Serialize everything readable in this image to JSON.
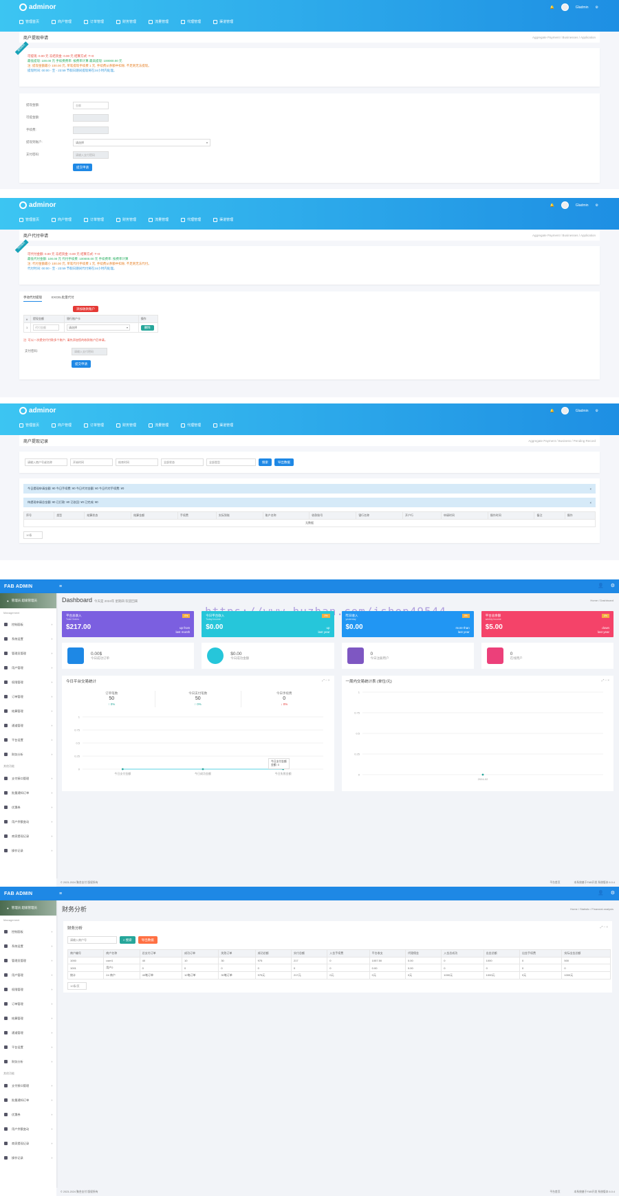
{
  "adminor": {
    "logo": "adminor",
    "user": "Gladmin",
    "menu": [
      "管理首页",
      "商户管理",
      "订单管理",
      "财务管理",
      "流量管理",
      "代理管理",
      "渠道管理"
    ]
  },
  "s1": {
    "title": "商户提现申请",
    "crumb": "Aggregate Payment / Businesses / Application",
    "ribbon": "提现规则",
    "notice": [
      "可提现: 0.00 元   冻结资金: 0.00 元   结算方式: T+0",
      "最低提现: 100.00 元   手续费费率: 按费率计算   最高提现: 100000.00 元",
      "注: 提现金额最小 100.00 元, 单笔提现手续费 1 元, 手续费从余额中扣除, 不足则无法提现。",
      "提现时间: 00:00 - 至 - 23:59 节假日期间提现将在24小时内处理。"
    ],
    "fields": [
      {
        "label": "提现金额:",
        "value": "金额"
      },
      {
        "label": "可提金额:",
        "value": ""
      },
      {
        "label": "手续费:",
        "value": ""
      },
      {
        "label": "提现到账户:",
        "value": "请选择"
      },
      {
        "label": "支付密码:",
        "value": "请输入支付密码"
      }
    ],
    "submit": "提交申请"
  },
  "s2": {
    "title": "商户代付申请",
    "crumb": "Aggregate Payment / Businesses / Application",
    "ribbon": "代付规则",
    "notice": [
      "可代付金额: 0.00 元   冻结资金: 0.00 元   结算方式: T+0",
      "最低代付金额: 100.00 元   代付手续费: 100000.00 元   手续费率: 按费率计算",
      "注: 代付金额最小 100.00 元, 单笔代付手续费 1 元, 手续费从余额中扣除, 不足则无法代付。",
      "代付时间: 00:00 - 至 - 23:59 节假日期间代付将在24小时内处理。"
    ],
    "tabs": [
      "手动代付提现",
      "EXCEL批量代付"
    ],
    "add_button": "添加收款账户",
    "headers": [
      "#",
      "提现金额",
      "银行账户卡",
      "操作"
    ],
    "row": {
      "no": "1",
      "amount": "代付金额",
      "bank": "请选择",
      "action": "删除"
    },
    "tip": "注: 可以一次提交代付款多个账户, 请先添加您的收款账户后申请。",
    "pwd_label": "支付密码:",
    "pwd_placeholder": "请输入支付密码",
    "submit": "提交申请"
  },
  "s3": {
    "title": "商户提现记录",
    "crumb": "Aggregate Payment / Business / Pending Record",
    "filters": [
      "请输入商户号或名称",
      "开始时间",
      "结束时间",
      "全部状态",
      "全部类型"
    ],
    "search": "搜索",
    "export": "导出数据",
    "alert1": "今日提现申请金额: ¥0  今日手续费: ¥0  今日代付金额: ¥0  今日代付手续费: ¥0",
    "alert2": "待提现申请总金额: ¥0  已打款: ¥0  已驳回: ¥0  已完成: ¥0",
    "headers": [
      "序号",
      "类型",
      "结算状态",
      "结算金额",
      "手续费",
      "实际到账",
      "账户名称",
      "收款账号",
      "银行名称",
      "开户行",
      "申请时间",
      "操作时间",
      "备注",
      "操作"
    ],
    "empty": "无数据",
    "pagesize": "10条"
  },
  "fab": {
    "logo": "FAB ADMIN",
    "profile": "管理员 超级管理员",
    "section1": "Management",
    "section2": "其他功能",
    "items1": [
      "控制面板",
      "系统设置",
      "管理员管理",
      "用户管理",
      "权限管理",
      "订单管理",
      "结算管理",
      "通道管理",
      "平台设置",
      "财务分析"
    ],
    "items2": [
      "支付接口管理",
      "批量通知订单",
      "优惠券",
      "用户余额变动",
      "商家提现记录",
      "操作记录"
    ],
    "footer_left": "© 2023-2024 聚合支付 版权所有",
    "footer_mid": "平台首页",
    "footer_right": "本系统基于FAB开发 系统版本 6.0.4"
  },
  "dash": {
    "title": "Dashboard",
    "subtitle": "今天是 2024年 星期四 欢迎回来",
    "crumb": "Home / Dashboard",
    "watermark": "https://www.huzhan.com/ishop49544",
    "stats": [
      {
        "label": "平台总收入",
        "sub": "Total Orders",
        "value": "$217.00",
        "badge": "0%",
        "trend": "up from",
        "trend2": "last month",
        "color": "#7b5fe0"
      },
      {
        "label": "今日平台收入",
        "sub": "Today income",
        "value": "$0.00",
        "badge": "0%",
        "trend": "up",
        "trend2": "last year",
        "color": "#26c6da"
      },
      {
        "label": "昨日收入",
        "sub": "yesterday",
        "value": "$0.00",
        "badge": "0%",
        "trend": "more than",
        "trend2": "last year",
        "color": "#2196f3"
      },
      {
        "label": "平台总余额",
        "sub": "weekly income",
        "value": "$5.00",
        "badge": "0%",
        "trend": "down",
        "trend2": "last year",
        "color": "#f44369"
      }
    ],
    "mini": [
      {
        "value": "0.00$",
        "label": "今日成功订单",
        "color": "#1e88e5",
        "round": false
      },
      {
        "value": "$0.00",
        "label": "今日成功金额",
        "color": "#26c6da",
        "round": true
      },
      {
        "value": "0",
        "label": "今日注册用户",
        "color": "#7e57c2",
        "round": false
      },
      {
        "value": "0",
        "label": "在线用户",
        "color": "#ec407a",
        "round": false
      }
    ],
    "panel1": {
      "title": "今日平台交易统计",
      "stats": [
        {
          "label": "订单笔数",
          "value": "50",
          "delta": "↑ 0%"
        },
        {
          "label": "今日支付笔数",
          "value": "50",
          "delta": "↑ 0%"
        },
        {
          "label": "今日手续费",
          "value": "0",
          "delta": "↓ 0%"
        }
      ],
      "tooltip": "今日支付金额",
      "tooltip2": "金额: 0"
    },
    "panel2": {
      "title": "一周内交易统计表 (单位/元)"
    },
    "chart_data": [
      {
        "type": "line",
        "categories": [
          "今日支付金额",
          "今日成功金额",
          "今日失败金额"
        ],
        "series": [
          {
            "name": "今日支付金额",
            "values": [
              0,
              0,
              0
            ]
          }
        ],
        "ylim": [
          0,
          1
        ],
        "ytick_labels": [
          "1",
          "0.75",
          "0.5",
          "0.25",
          "0"
        ]
      },
      {
        "type": "scatter",
        "categories": [
          "2024-02"
        ],
        "series": [
          {
            "values": [
              0
            ]
          }
        ],
        "ylim": [
          0,
          1
        ],
        "ytick_labels": [
          "1",
          "0.75",
          "0.5",
          "0.25",
          "0"
        ]
      }
    ]
  },
  "fin": {
    "title": "财务分析",
    "crumb": "Home / Statistic / Financial analysis",
    "panel_title": "财务分析",
    "input_placeholder": "请输入商户号",
    "search": "搜索",
    "export": "导出数据",
    "headers": [
      "商户编号",
      "商户名称",
      "总支付订单",
      "成功订单",
      "失败订单",
      "成功总额",
      "实付总额",
      "入金手续费",
      "平台收支",
      "代理佣金",
      "入金总成功",
      "出金总额",
      "出金手续费",
      "实际出金总额"
    ],
    "rows": [
      [
        "1000",
        "user1",
        "40",
        "10",
        "30",
        "975",
        "217",
        "0",
        "1057.50",
        "0.00",
        "0",
        "1000",
        "0",
        "500"
      ],
      [
        "1001",
        "用户2",
        "0",
        "0",
        "0",
        "0",
        "0",
        "0",
        "0.00",
        "0.00",
        "0",
        "0",
        "0",
        "0"
      ],
      [
        "统计",
        "24 商户",
        "40笔订单",
        "10笔订单",
        "30笔订单",
        "975元",
        "217元",
        "0元",
        "0元",
        "0元",
        "1000元",
        "1000元",
        "0元",
        "1000元"
      ]
    ],
    "pagesize": "10条/页"
  }
}
